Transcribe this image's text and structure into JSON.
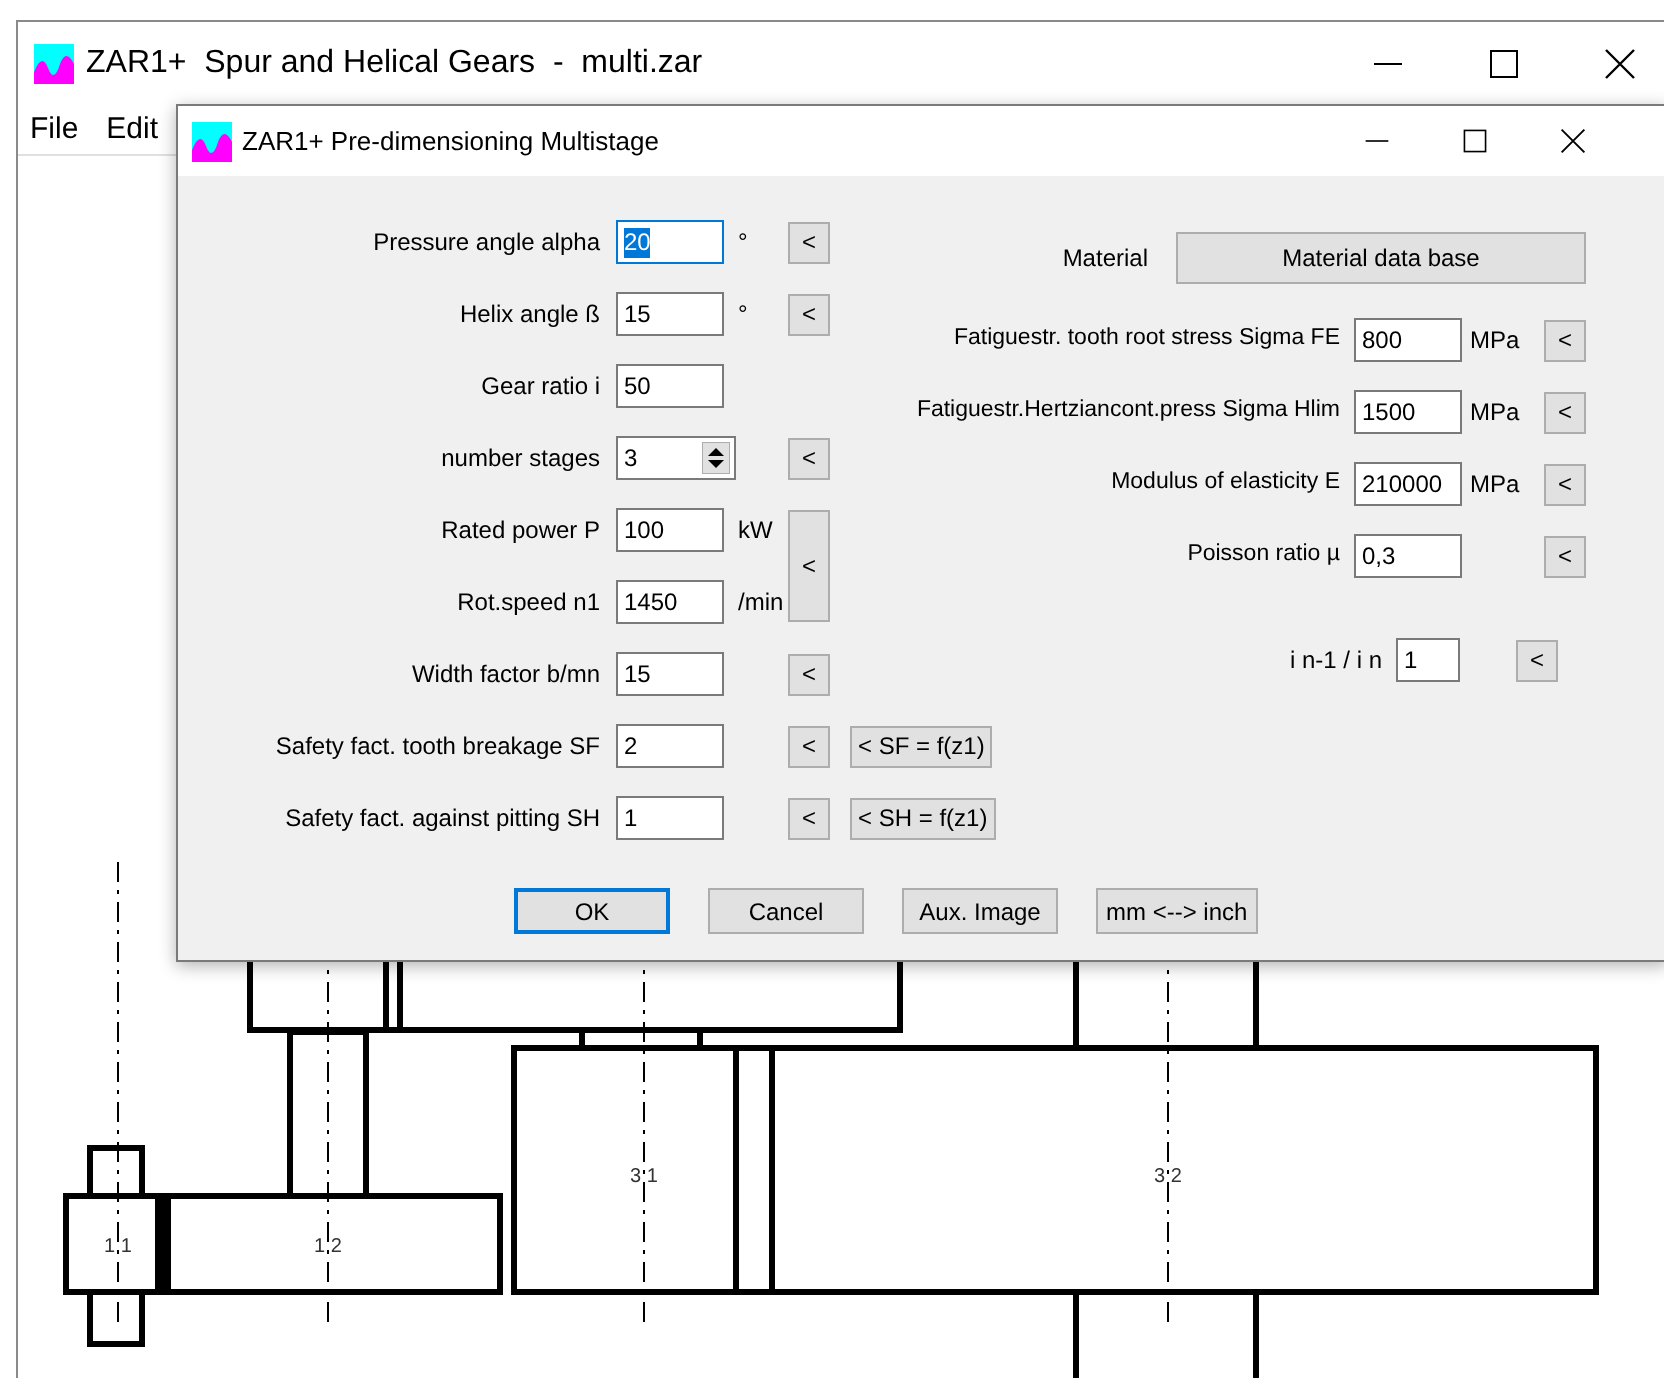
{
  "main_window": {
    "title": "ZAR1+  Spur and Helical Gears  -  multi.zar",
    "menu": [
      "File",
      "Edit"
    ]
  },
  "drawing": {
    "labels": [
      "1 1",
      "1 2",
      "3 1",
      "3 2"
    ]
  },
  "dialog": {
    "title": "ZAR1+ Pre-dimensioning Multistage",
    "left_fields": [
      {
        "kind": "text",
        "label": "Pressure angle alpha",
        "value": "20",
        "unit": "°",
        "focused": true,
        "button": "<"
      },
      {
        "kind": "text",
        "label": "Helix angle ß",
        "value": "15",
        "unit": "°",
        "focused": false,
        "button": "<"
      },
      {
        "kind": "text",
        "label": "Gear ratio i",
        "value": "50",
        "focused": false
      },
      {
        "kind": "spinner",
        "label": "number stages",
        "value": "3",
        "focused": false,
        "button": "<"
      },
      {
        "kind": "group",
        "button": "<",
        "fields": [
          {
            "label": "Rated power P",
            "value": "100",
            "unit": "kW",
            "focused": false
          },
          {
            "label": "Rot.speed n1",
            "value": "1450",
            "unit": "/min",
            "focused": false
          }
        ]
      },
      {
        "kind": "text",
        "label": "Width factor b/mn",
        "value": "15",
        "focused": false,
        "button": "<"
      },
      {
        "kind": "text",
        "label": "Safety fact. tooth breakage SF",
        "value": "2",
        "focused": false,
        "button": "<",
        "extra": "< SF = f(z1)"
      },
      {
        "kind": "text",
        "label": "Safety fact. against pitting SH",
        "value": "1",
        "focused": false,
        "button": "<",
        "extra": "< SH = f(z1)"
      }
    ],
    "material": {
      "label": "Material",
      "button": "Material data base"
    },
    "right_fields": [
      {
        "label": "Fatiguestr. tooth root stress Sigma FE",
        "value": "800",
        "unit": "MPa",
        "button": "<"
      },
      {
        "label": "Fatiguestr.Hertziancont.press Sigma Hlim",
        "value": "1500",
        "unit": "MPa",
        "button": "<"
      },
      {
        "label": "Modulus of elasticity E",
        "value": "210000",
        "unit": "MPa",
        "button": "<"
      },
      {
        "label": "Poisson ratio µ",
        "value": "0,3",
        "button": "<"
      }
    ],
    "ratio_field": {
      "label": "i n-1 / i n",
      "value": "1",
      "button": "<"
    },
    "buttons": [
      {
        "label": "OK",
        "default": true
      },
      {
        "label": "Cancel",
        "default": false
      },
      {
        "label": "Aux. Image",
        "default": false
      },
      {
        "label": "mm <--> inch",
        "default": false
      }
    ]
  }
}
